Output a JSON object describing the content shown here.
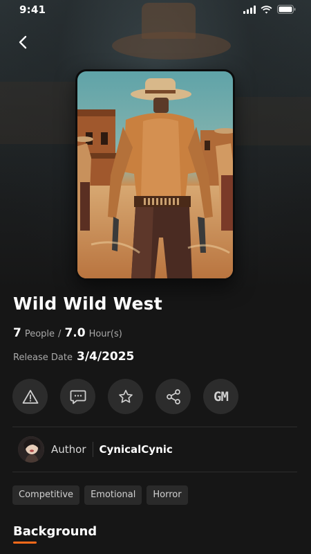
{
  "status_bar": {
    "time": "9:41"
  },
  "game": {
    "title": "Wild Wild West",
    "players": "7",
    "players_unit": "People",
    "meta_separator": "/",
    "duration": "7.0",
    "duration_unit": "Hour(s)",
    "release_label": "Release Date",
    "release_date": "3/4/2025"
  },
  "actions": [
    {
      "icon": "warning-icon"
    },
    {
      "icon": "chat-icon"
    },
    {
      "icon": "star-icon"
    },
    {
      "icon": "share-icon"
    },
    {
      "icon": "gm-icon",
      "label": "GM"
    }
  ],
  "author": {
    "label": "Author",
    "name": "CynicalCynic"
  },
  "tags": [
    "Competitive",
    "Emotional",
    "Horror"
  ],
  "section": {
    "title": "Background"
  },
  "colors": {
    "accent": "#ff6a1a",
    "background": "#161616",
    "button": "#2c2c2c"
  }
}
